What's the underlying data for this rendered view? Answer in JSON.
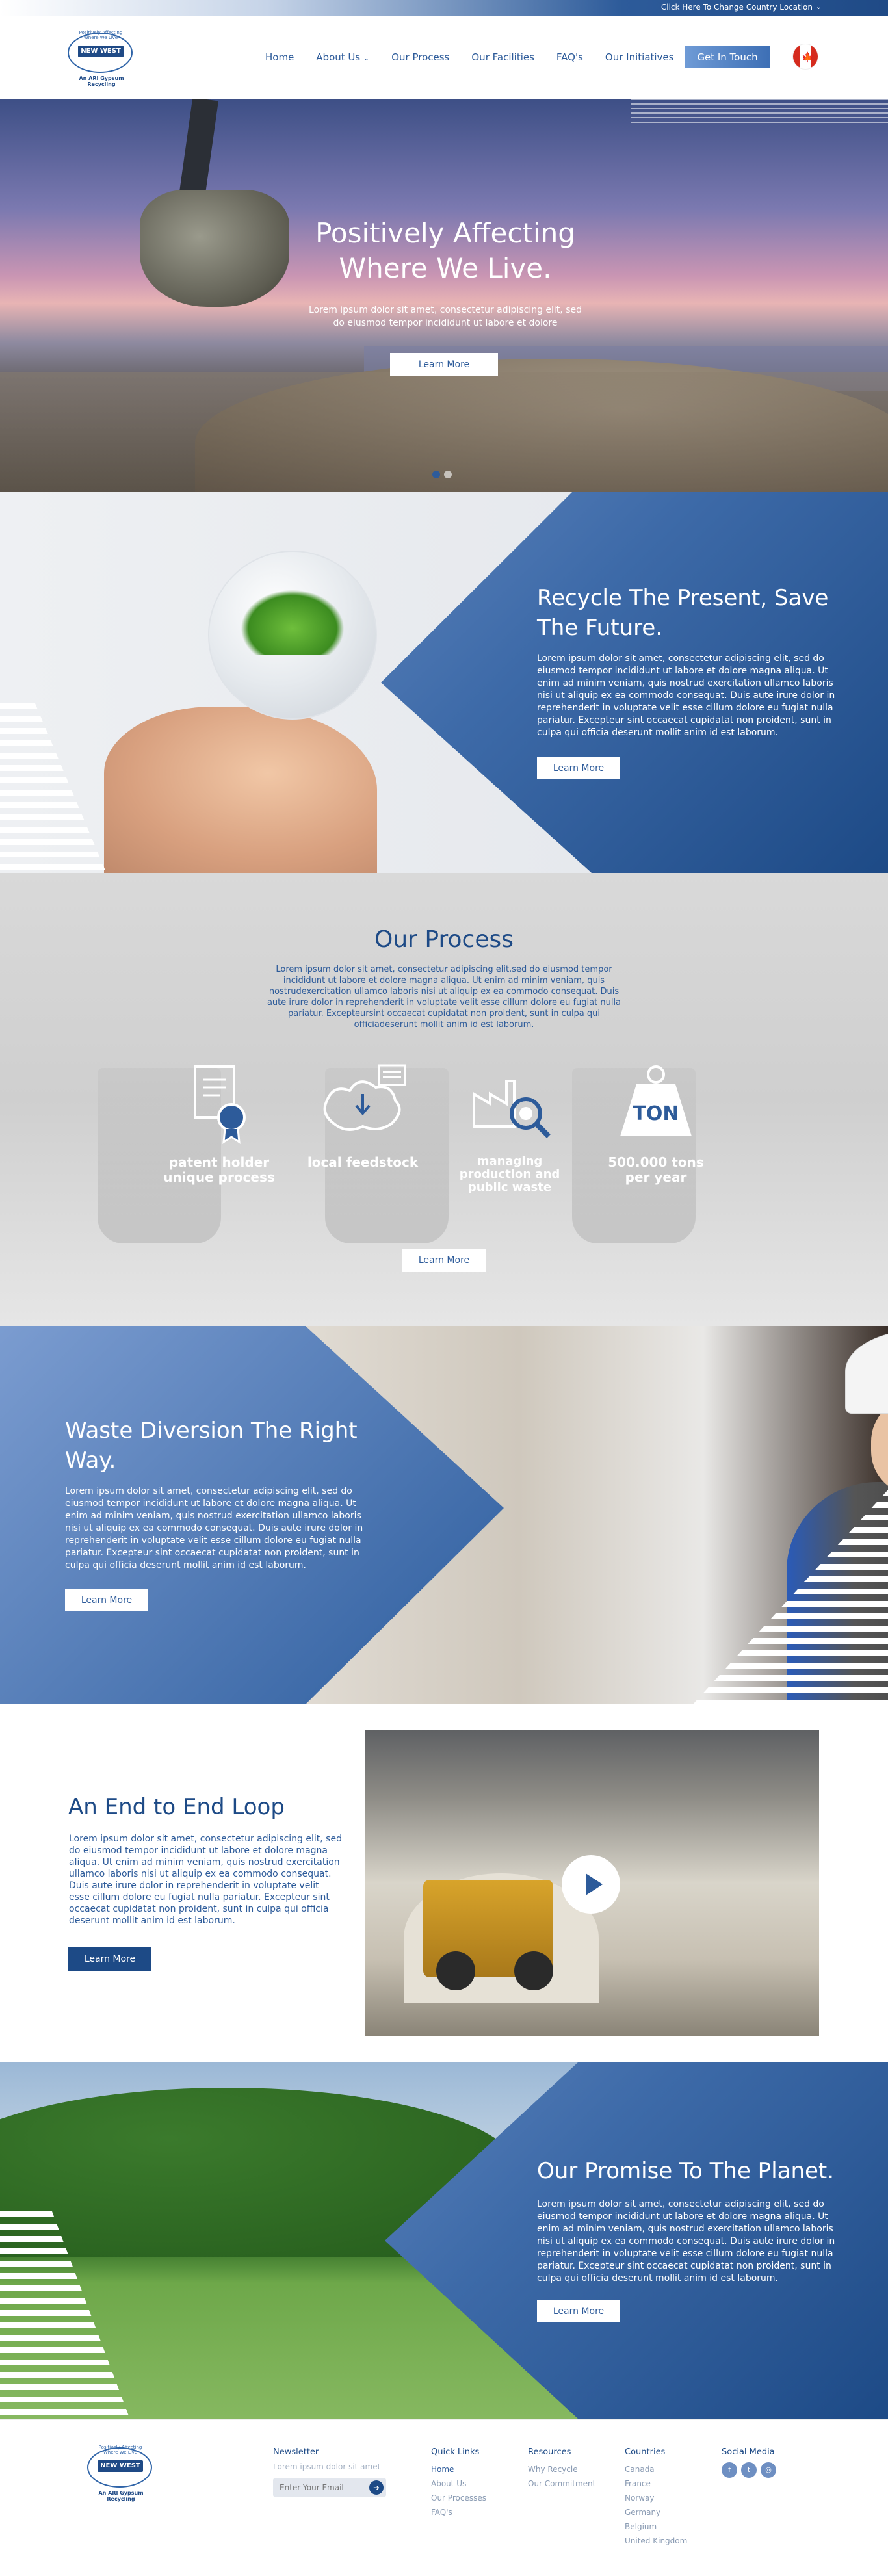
{
  "topbar": {
    "country_link": "Click Here To Change Country Location"
  },
  "header": {
    "logo": {
      "tagline": "Positively Affecting Where We Live",
      "name": "NEW WEST",
      "sub": "An ARI Gypsum Recycling"
    },
    "nav": [
      "Home",
      "About Us",
      "Our Process",
      "Our Facilities",
      "FAQ's",
      "Our Initiatives"
    ],
    "cta": "Get In Touch",
    "colors": {
      "brand": "#1d4a86",
      "accent": "#3d6fb5",
      "flag_red": "#d52b1e"
    }
  },
  "hero": {
    "title": "Positively Affecting Where We Live.",
    "text": "Lorem ipsum dolor sit amet, consectetur adipiscing elit, sed do eiusmod tempor incididunt ut labore et dolore",
    "button": "Learn More"
  },
  "recycle": {
    "title": "Recycle The Present, Save The Future.",
    "text": "Lorem ipsum dolor sit amet, consectetur adipiscing elit, sed do eiusmod tempor incididunt ut labore et dolore magna aliqua. Ut enim ad minim veniam, quis nostrud exercitation ullamco laboris nisi ut aliquip ex ea commodo consequat. Duis aute irure dolor in reprehenderit in voluptate velit esse cillum dolore eu fugiat nulla pariatur. Excepteur sint occaecat cupidatat non proident, sunt in culpa qui officia deserunt mollit anim id est laborum.",
    "button": "Learn More"
  },
  "process": {
    "title": "Our Process",
    "intro": "Lorem ipsum dolor sit amet, consectetur adipiscing elit,sed do eiusmod tempor incididunt ut labore et dolore magna aliqua. Ut enim ad minim veniam, quis nostrudexercitation ullamco laboris nisi ut aliquip ex ea commodo consequat. Duis aute irure dolor in reprehenderit in voluptate velit esse cillum dolore eu fugiat nulla pariatur. Excepteursint occaecat cupidatat non proident, sunt in culpa qui officiadeserunt mollit anim id est laborum.",
    "features": [
      {
        "label": "patent holder unique process",
        "icon": "certificate-icon"
      },
      {
        "label": "local feedstock",
        "icon": "map-pin-icon"
      },
      {
        "label": "managing production and public waste",
        "icon": "factory-search-icon"
      },
      {
        "label": "500.000 tons per year",
        "icon": "weight-icon",
        "badge": "TON"
      }
    ],
    "button": "Learn More"
  },
  "waste": {
    "title": "Waste Diversion The Right Way.",
    "text": "Lorem ipsum dolor sit amet, consectetur adipiscing elit, sed do eiusmod tempor incididunt ut labore et dolore magna aliqua. Ut enim ad minim veniam, quis nostrud exercitation ullamco laboris nisi ut aliquip ex ea commodo consequat. Duis aute irure dolor in reprehenderit in voluptate velit esse cillum dolore eu fugiat nulla pariatur. Excepteur sint occaecat cupidatat non proident, sunt in culpa qui officia deserunt mollit anim id est laborum.",
    "button": "Learn More"
  },
  "loop": {
    "title": "An End to End Loop",
    "text": "Lorem ipsum dolor sit amet, consectetur adipiscing elit, sed do eiusmod tempor incididunt ut labore et dolore magna aliqua. Ut enim ad minim veniam, quis nostrud exercitation ullamco laboris nisi ut aliquip ex ea commodo consequat. Duis aute irure dolor in reprehenderit in voluptate velit esse cillum dolore eu fugiat nulla pariatur. Excepteur sint occaecat cupidatat non proident, sunt in culpa qui officia deserunt mollit anim id est laborum.",
    "button": "Learn More"
  },
  "promise": {
    "title": "Our Promise To The Planet.",
    "text": "Lorem ipsum dolor sit amet, consectetur adipiscing elit, sed do eiusmod tempor incididunt ut labore et dolore magna aliqua. Ut enim ad minim veniam, quis nostrud exercitation ullamco laboris nisi ut aliquip ex ea commodo consequat. Duis aute irure dolor in reprehenderit in voluptate velit esse cillum dolore eu fugiat nulla pariatur. Excepteur sint occaecat cupidatat non proident, sunt in culpa qui officia deserunt mollit anim id est laborum.",
    "button": "Learn More"
  },
  "footer": {
    "newsletter": {
      "title": "Newsletter",
      "hint": "Lorem ipsum dolor sit amet",
      "placeholder": "Enter Your Email"
    },
    "quick_links": {
      "title": "Quick Links",
      "items": [
        "Home",
        "About Us",
        "Our Processes",
        "FAQ's"
      ]
    },
    "resources": {
      "title": "Resources",
      "items": [
        "Why Recycle",
        "Our Commitment"
      ]
    },
    "countries": {
      "title": "Countries",
      "items": [
        "Canada",
        "France",
        "Norway",
        "Germany",
        "Belgium",
        "United Kingdom"
      ]
    },
    "social": {
      "title": "Social Media",
      "icons": [
        "facebook-icon",
        "twitter-icon",
        "instagram-icon"
      ]
    }
  }
}
